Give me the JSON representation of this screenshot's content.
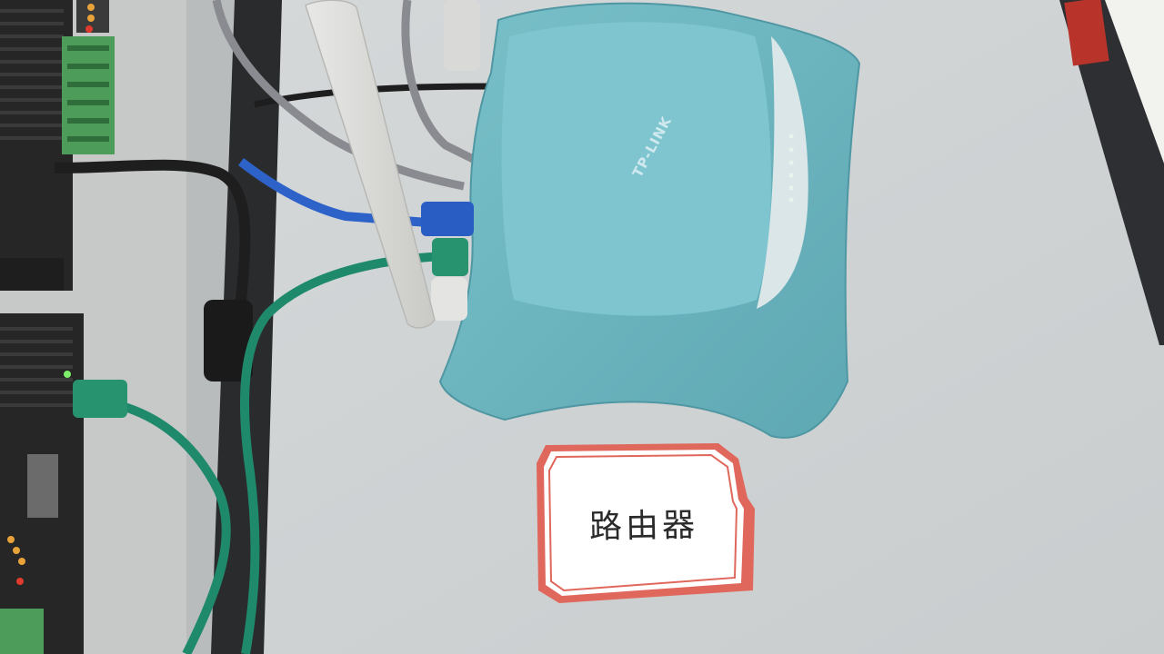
{
  "photo": {
    "label_card_text": "路由器",
    "router_brand": "TP-LINK",
    "colors": {
      "desk": "#cfd3d4",
      "router_body": "#6fb7c1",
      "router_top_panel": "#7cc3cd",
      "card_border": "#e0675c",
      "cable_green": "#1f8a6b",
      "cable_blue": "#2d62c9",
      "cable_gray": "#8a8b90",
      "cable_black": "#1e1e1e",
      "device_dark": "#2b2b2b"
    }
  }
}
